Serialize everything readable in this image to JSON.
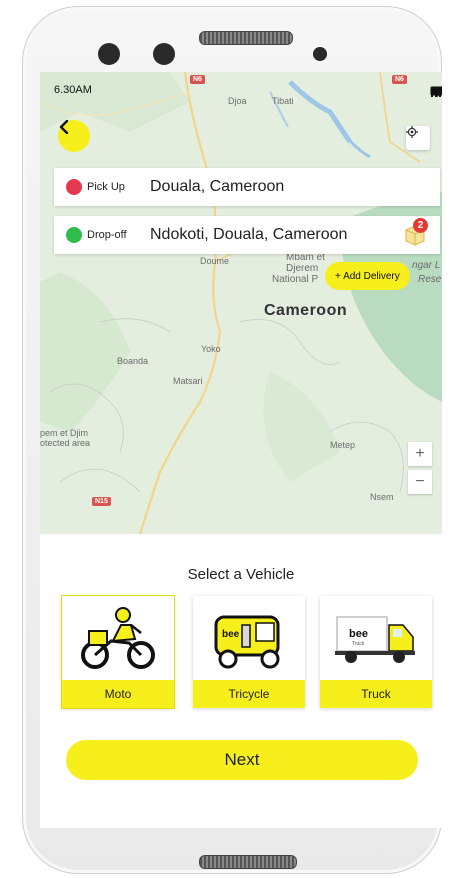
{
  "status_bar": {
    "time": "6.30AM"
  },
  "map": {
    "labels": {
      "region": "Cameroon",
      "djoa": "Djoa",
      "tibati": "Tibati",
      "doume": "Doume",
      "mbam": "Mbam et",
      "djerem": "Djerem",
      "national": "National P",
      "yoko": "Yoko",
      "boanda": "Boanda",
      "matsari": "Matsari",
      "pem_line1": "pem et Djim",
      "pem_line2": "otected area",
      "metep": "Metep",
      "nsem": "Nsem",
      "gangar": "ngar L",
      "reserve": "Rese"
    },
    "road_shields": [
      "N6",
      "N6",
      "N15"
    ]
  },
  "pickup": {
    "label": "Pick Up",
    "value": "Douala, Cameroon"
  },
  "dropoff": {
    "label": "Drop-off",
    "value": "Ndokoti, Douala, Cameroon",
    "badge": "2"
  },
  "add_delivery_label": "+ Add Delivery",
  "zoom": {
    "in": "+",
    "out": "−"
  },
  "panel": {
    "title": "Select a Vehicle",
    "vehicles": [
      {
        "label": "Moto",
        "selected": true
      },
      {
        "label": "Tricycle",
        "selected": false
      },
      {
        "label": "Truck",
        "selected": false
      }
    ],
    "next_label": "Next"
  },
  "colors": {
    "accent_yellow": "#f7ef1b",
    "pickup_red": "#e53950",
    "dropoff_green": "#2ebd4a",
    "badge_red": "#e53935"
  }
}
